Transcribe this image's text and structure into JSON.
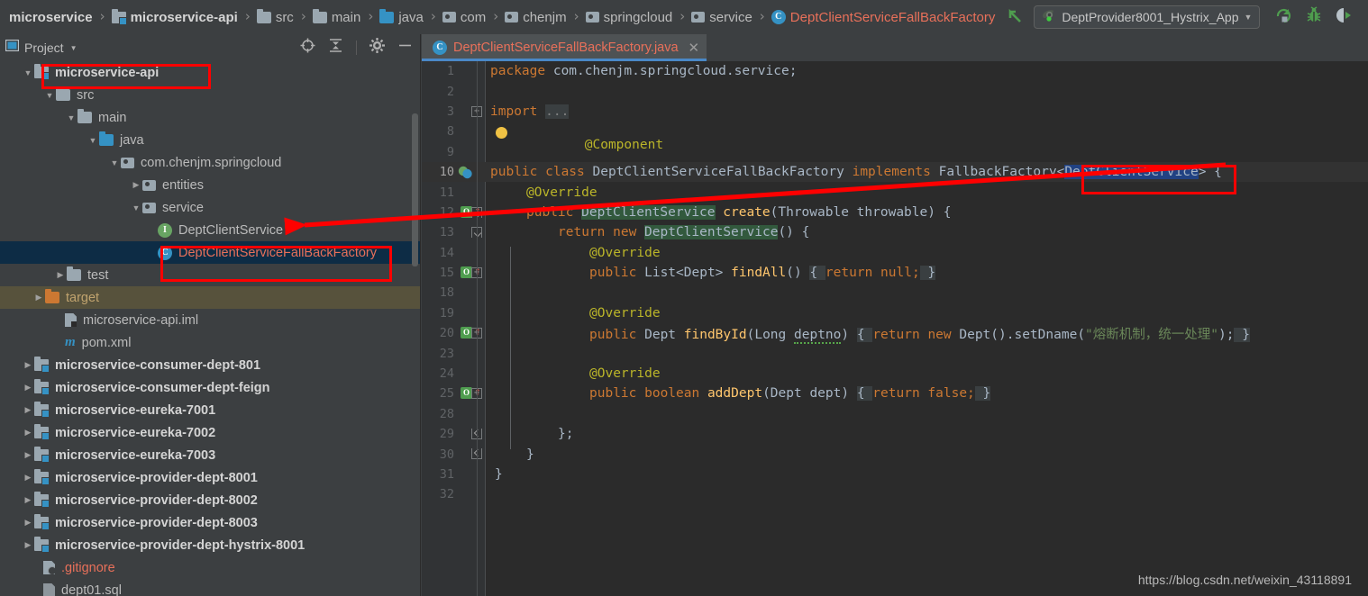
{
  "window": {
    "theme_bg": "#3c3f41",
    "editor_bg": "#2b2b2b",
    "accent": "#3592c4",
    "annotation_color": "#ff0000"
  },
  "navbar": {
    "breadcrumbs": [
      {
        "label": "microservice",
        "icon": "none",
        "style": "bold"
      },
      {
        "label": "microservice-api",
        "icon": "module-icon",
        "style": "bold"
      },
      {
        "label": "src",
        "icon": "folder-icon",
        "style": "normal"
      },
      {
        "label": "main",
        "icon": "folder-icon",
        "style": "normal"
      },
      {
        "label": "java",
        "icon": "source-folder-icon",
        "style": "normal"
      },
      {
        "label": "com",
        "icon": "package-icon",
        "style": "normal"
      },
      {
        "label": "chenjm",
        "icon": "package-icon",
        "style": "normal"
      },
      {
        "label": "springcloud",
        "icon": "package-icon",
        "style": "normal"
      },
      {
        "label": "service",
        "icon": "package-icon",
        "style": "normal"
      },
      {
        "label": "DeptClientServiceFallBackFactory",
        "icon": "class-icon",
        "style": "orange"
      }
    ],
    "separator": "›",
    "run_config": {
      "label": "DeptProvider8001_Hystrix_App",
      "caret": "▼",
      "icon": "spring-boot-run-icon"
    },
    "buttons": [
      {
        "name": "run-button",
        "icon": "run-icon"
      },
      {
        "name": "debug-button",
        "icon": "bug-icon"
      },
      {
        "name": "run-with-coverage-button",
        "icon": "coverage-icon"
      }
    ],
    "nav_back_icon": "green-arrow-icon"
  },
  "project_panel": {
    "title": "Project",
    "title_caret": "▼",
    "header_buttons": [
      {
        "name": "locate-button",
        "icon": "crosshair-icon"
      },
      {
        "name": "collapse-all-button",
        "icon": "collapse-all-icon"
      },
      {
        "name": "settings-button",
        "icon": "gear-icon"
      },
      {
        "name": "hide-panel-button",
        "icon": "minus-icon"
      }
    ],
    "tree": [
      {
        "label": "microservice-api",
        "indent": 1,
        "twisty": "▼",
        "icon": "module-icon",
        "style": "module",
        "boxed": true
      },
      {
        "label": "src",
        "indent": 2,
        "twisty": "▼",
        "icon": "folder-icon",
        "style": "normal"
      },
      {
        "label": "main",
        "indent": 3,
        "twisty": "▼",
        "icon": "folder-icon",
        "style": "normal"
      },
      {
        "label": "java",
        "indent": 4,
        "twisty": "▼",
        "icon": "source-folder-icon",
        "style": "normal"
      },
      {
        "label": "com.chenjm.springcloud",
        "indent": 5,
        "twisty": "▼",
        "icon": "package-icon",
        "style": "normal"
      },
      {
        "label": "entities",
        "indent": 6,
        "twisty": "▶",
        "icon": "package-icon",
        "style": "normal"
      },
      {
        "label": "service",
        "indent": 6,
        "twisty": "▼",
        "icon": "package-icon",
        "style": "normal"
      },
      {
        "label": "DeptClientService",
        "indent": 7,
        "twisty": "",
        "icon": "interface-icon",
        "style": "normal"
      },
      {
        "label": "DeptClientServiceFallBackFactory",
        "indent": 7,
        "twisty": "",
        "icon": "class-icon",
        "style": "red",
        "selected": true,
        "boxed": true
      },
      {
        "label": "test",
        "indent": 3,
        "twisty": "▶",
        "icon": "folder-icon",
        "style": "normal"
      },
      {
        "label": "target",
        "indent": 2,
        "twisty": "▶",
        "icon": "orange-folder-icon",
        "style": "target"
      },
      {
        "label": "microservice-api.iml",
        "indent": 3,
        "twisty": "",
        "icon": "iml-file-icon",
        "style": "normal"
      },
      {
        "label": "pom.xml",
        "indent": 3,
        "twisty": "",
        "icon": "maven-icon",
        "style": "normal"
      },
      {
        "label": "microservice-consumer-dept-801",
        "indent": 1,
        "twisty": "▶",
        "icon": "module-icon",
        "style": "module"
      },
      {
        "label": "microservice-consumer-dept-feign",
        "indent": 1,
        "twisty": "▶",
        "icon": "module-icon",
        "style": "module"
      },
      {
        "label": "microservice-eureka-7001",
        "indent": 1,
        "twisty": "▶",
        "icon": "module-icon",
        "style": "module"
      },
      {
        "label": "microservice-eureka-7002",
        "indent": 1,
        "twisty": "▶",
        "icon": "module-icon",
        "style": "module"
      },
      {
        "label": "microservice-eureka-7003",
        "indent": 1,
        "twisty": "▶",
        "icon": "module-icon",
        "style": "module"
      },
      {
        "label": "microservice-provider-dept-8001",
        "indent": 1,
        "twisty": "▶",
        "icon": "module-icon",
        "style": "module"
      },
      {
        "label": "microservice-provider-dept-8002",
        "indent": 1,
        "twisty": "▶",
        "icon": "module-icon",
        "style": "module"
      },
      {
        "label": "microservice-provider-dept-8003",
        "indent": 1,
        "twisty": "▶",
        "icon": "module-icon",
        "style": "module"
      },
      {
        "label": "microservice-provider-dept-hystrix-8001",
        "indent": 1,
        "twisty": "▶",
        "icon": "module-icon",
        "style": "module"
      },
      {
        "label": ".gitignore",
        "indent": 2,
        "twisty": "",
        "icon": "gitignore-icon",
        "style": "red"
      },
      {
        "label": "dept01.sql",
        "indent": 2,
        "twisty": "",
        "icon": "sql-file-icon",
        "style": "normal"
      }
    ]
  },
  "editor": {
    "tab": {
      "label": "DeptClientServiceFallBackFactory.java",
      "icon": "class-icon",
      "close": "✕"
    },
    "lines": [
      {
        "num": "1",
        "indent": 0
      },
      {
        "num": "2",
        "indent": 0
      },
      {
        "num": "3",
        "indent": 0
      },
      {
        "num": "8",
        "indent": 0
      },
      {
        "num": "9",
        "indent": 0
      },
      {
        "num": "10",
        "indent": 0,
        "caret": true
      },
      {
        "num": "11",
        "indent": 0
      },
      {
        "num": "12",
        "indent": 0
      },
      {
        "num": "13",
        "indent": 0
      },
      {
        "num": "14",
        "indent": 0
      },
      {
        "num": "15",
        "indent": 0
      },
      {
        "num": "18",
        "indent": 0
      },
      {
        "num": "19",
        "indent": 0
      },
      {
        "num": "20",
        "indent": 0
      },
      {
        "num": "23",
        "indent": 0
      },
      {
        "num": "24",
        "indent": 0
      },
      {
        "num": "25",
        "indent": 0
      },
      {
        "num": "28",
        "indent": 0
      },
      {
        "num": "29",
        "indent": 0
      },
      {
        "num": "30",
        "indent": 0
      },
      {
        "num": "31",
        "indent": 0
      },
      {
        "num": "32",
        "indent": 0
      }
    ],
    "code": {
      "l1_kw": "package",
      "l1_pkg": " com.chenjm.springcloud.service;",
      "l3_kw": "import",
      "l3_fold": "...",
      "l9_ann": "@Component",
      "l10_a": "public class ",
      "l10_cls": "DeptClientServiceFallBackFactory",
      "l10_b": " implements ",
      "l10_iface": "FallbackFactory<",
      "l10_sel": "DeptClientService",
      "l10_c": "> {",
      "l11_ann": "@Override",
      "l12_a": "public ",
      "l12_type": "DeptClientService",
      "l12_b": " ",
      "l12_fn": "create",
      "l12_c": "(Throwable throwable) {",
      "l13_a": "return new ",
      "l13_type": "DeptClientService",
      "l13_b": "() {",
      "l14_ann": "@Override",
      "l15_a": "public ",
      "l15_type": "List<Dept> ",
      "l15_fn": "findAll",
      "l15_b": "() ",
      "l15_brace_open": "{ ",
      "l15_ret": "return ",
      "l15_null": "null;",
      "l15_brace_close": " }",
      "l19_ann": "@Override",
      "l20_a": "public ",
      "l20_type": "Dept ",
      "l20_fn": "findById",
      "l20_b": "(Long ",
      "l20_param": "deptno",
      "l20_c": ") ",
      "l20_brace_open": "{ ",
      "l20_ret": "return ",
      "l20_new": "new ",
      "l20_d": "Dept().",
      "l20_setter": "setDname",
      "l20_e": "(",
      "l20_str": "\"熔断机制，统一处理\"",
      "l20_f": ");",
      "l20_brace_close": " }",
      "l24_ann": "@Override",
      "l25_a": "public boolean ",
      "l25_fn": "addDept",
      "l25_b": "(Dept dept) ",
      "l25_brace_open": "{ ",
      "l25_ret": "return ",
      "l25_false": "false;",
      "l25_brace_close": " }",
      "l29": "};",
      "l30": "}",
      "l31": "}"
    }
  },
  "annotations": {
    "boxes": [
      {
        "name": "highlight-module-microservice-api"
      },
      {
        "name": "highlight-fallback-factory-file"
      },
      {
        "name": "highlight-generic-type-param"
      }
    ],
    "arrow": {
      "name": "red-pointer-arrow",
      "from": "generic-type-param",
      "to": "DeptClientService-file"
    }
  },
  "watermark": {
    "text": "https://blog.csdn.net/weixin_43118891"
  }
}
